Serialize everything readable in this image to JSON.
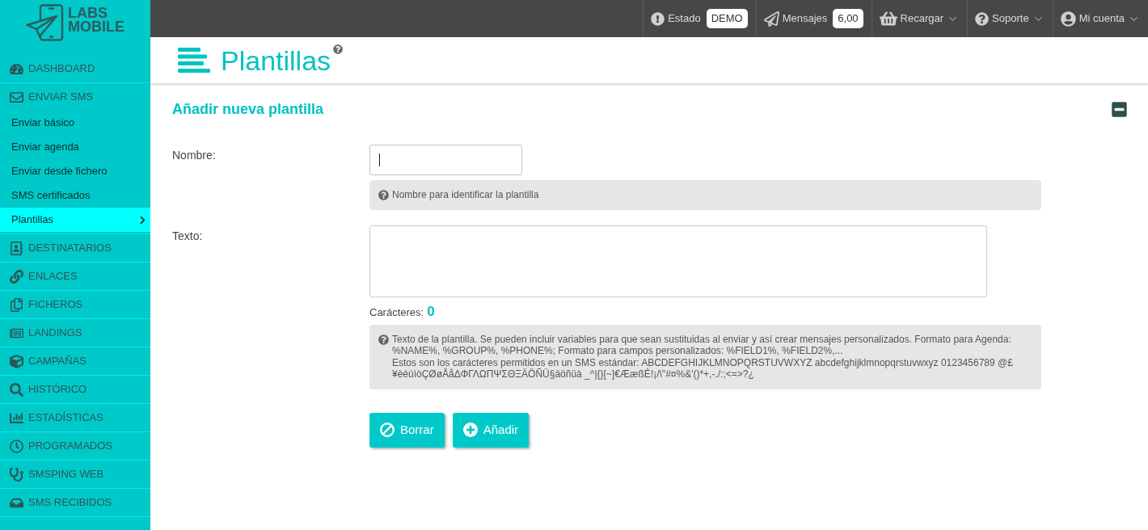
{
  "logo": {
    "lines": [
      "LABS",
      "MOBILE"
    ]
  },
  "sidebar": {
    "items": [
      {
        "label": "DASHBOARD",
        "selected": false
      },
      {
        "label": "ENVIAR SMS",
        "selected": false,
        "children": [
          {
            "label": "Enviar básico",
            "selected": false
          },
          {
            "label": "Enviar agenda",
            "selected": false
          },
          {
            "label": "Enviar desde fichero",
            "selected": false
          },
          {
            "label": "SMS certificados",
            "selected": false
          },
          {
            "label": "Plantillas",
            "selected": true
          }
        ]
      },
      {
        "label": "DESTINATARIOS",
        "selected": false
      },
      {
        "label": "ENLACES",
        "selected": false
      },
      {
        "label": "FICHEROS",
        "selected": false
      },
      {
        "label": "LANDINGS",
        "selected": false
      },
      {
        "label": "CAMPAÑAS",
        "selected": false
      },
      {
        "label": "HISTÓRICO",
        "selected": false
      },
      {
        "label": "ESTADÍSTICAS",
        "selected": false
      },
      {
        "label": "PROGRAMADOS",
        "selected": false
      },
      {
        "label": "SMSPING WEB",
        "selected": false
      },
      {
        "label": "SMS RECIBIDOS",
        "selected": false
      }
    ]
  },
  "topbar": {
    "items": [
      {
        "label": "Estado",
        "badge": "DEMO",
        "has_menu": false
      },
      {
        "label": "Mensajes",
        "badge": "6,00",
        "has_menu": false
      },
      {
        "label": "Recargar",
        "has_menu": true
      },
      {
        "label": "Soporte",
        "has_menu": true
      },
      {
        "label": "Mi cuenta",
        "has_menu": true
      }
    ]
  },
  "page_header": {
    "title": "Plantillas"
  },
  "section": {
    "title": "Añadir nueva plantilla",
    "expanded": true
  },
  "form": {
    "fields": [
      {
        "kind": "input",
        "label": "Nombre:",
        "focused": true,
        "hint": [
          "Nombre para identificar la plantilla"
        ]
      },
      {
        "kind": "textarea",
        "label": "Texto:",
        "focused": false,
        "counter": {
          "label": "Carácteres:",
          "value": "0"
        },
        "hint": [
          "Texto de la plantilla. Se pueden incluir variables para que sean sustituidas al enviar y así crear mensajes personalizados. Formato para Agenda: %NAME%, %GROUP%, %PHONE%; Formato para campos personalizados: %FIELD1%, %FIELD2%,...",
          "Estos son los carácteres permitidos en un SMS estándar: ABCDEFGHIJKLMNOPQRSTUVWXYZ abcdefghijklmnopqrstuvwxyz 0123456789 @£ ¥èéùìòÇØøÅåΔΦΓΛΩΠΨΣΘΞÄÖÑÜ§äöñüà _^|{}[~]€ÆæßÉ!¡/\\\"#¤%&'()*+,-./:;<=>?¿"
        ]
      }
    ],
    "buttons": [
      {
        "kind": "clear",
        "label": "Borrar"
      },
      {
        "kind": "add",
        "label": "Añadir"
      }
    ]
  }
}
